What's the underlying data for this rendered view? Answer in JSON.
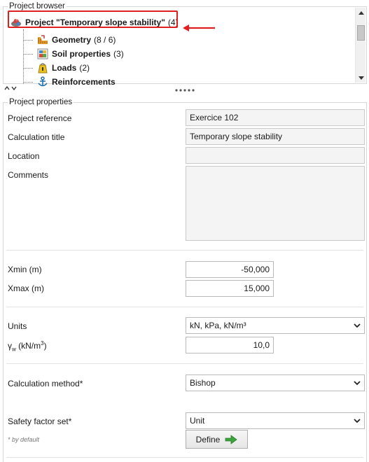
{
  "browser": {
    "title": "Project browser",
    "root": {
      "label": "Project \"Temporary slope stability\"",
      "count": "(4)"
    },
    "items": [
      {
        "label": "Geometry",
        "count": "(8 / 6)",
        "icon": "geometry-icon"
      },
      {
        "label": "Soil properties",
        "count": "(3)",
        "icon": "soil-properties-icon"
      },
      {
        "label": "Loads",
        "count": "(2)",
        "icon": "loads-icon"
      },
      {
        "label": "Reinforcements",
        "count": "",
        "icon": "anchor-icon"
      }
    ]
  },
  "props": {
    "title": "Project properties",
    "project_reference": {
      "label": "Project reference",
      "value": "Exercice 102"
    },
    "calculation_title": {
      "label": "Calculation title",
      "value": "Temporary slope stability"
    },
    "location": {
      "label": "Location",
      "value": ""
    },
    "comments": {
      "label": "Comments",
      "value": ""
    },
    "xmin": {
      "label": "Xmin (m)",
      "value": "-50,000"
    },
    "xmax": {
      "label": "Xmax (m)",
      "value": "15,000"
    },
    "units": {
      "label": "Units",
      "value": "kN, kPa, kN/m³"
    },
    "gamma_w": {
      "symbol": "γ",
      "sub": "w",
      "unit_pre": " (kN/m",
      "sup": "3",
      "unit_post": ")",
      "value": "10,0"
    },
    "method": {
      "label": "Calculation method*",
      "value": "Bishop"
    },
    "safety": {
      "label": "Safety factor set*",
      "value": "Unit"
    },
    "note": "* by default",
    "define_label": "Define"
  },
  "colors": {
    "highlight": "#e02020",
    "define_arrow": "#3aa53a"
  }
}
